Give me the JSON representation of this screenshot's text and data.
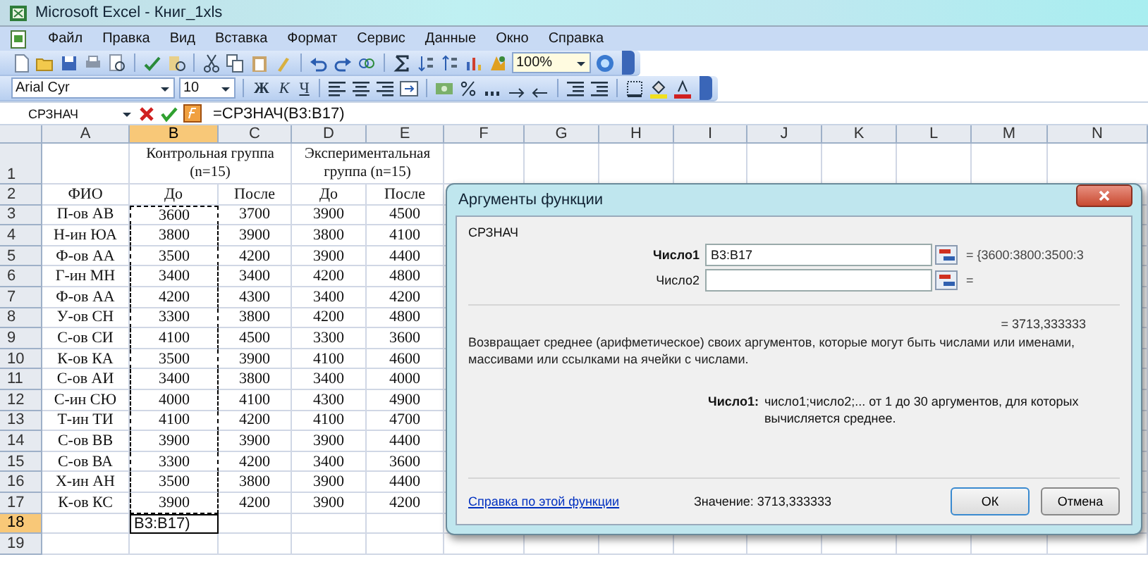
{
  "window": {
    "title": "Microsoft Excel - Книг_1xls"
  },
  "menu": [
    {
      "label": "Файл"
    },
    {
      "label": "Правка"
    },
    {
      "label": "Вид"
    },
    {
      "label": "Вставка"
    },
    {
      "label": "Формат"
    },
    {
      "label": "Сервис"
    },
    {
      "label": "Данные"
    },
    {
      "label": "Окно"
    },
    {
      "label": "Справка"
    }
  ],
  "standard_toolbar": {
    "zoom": "100%"
  },
  "format_toolbar": {
    "font": "Arial Cyr",
    "size": "10",
    "style_buttons": [
      "Ж",
      "К",
      "Ч"
    ]
  },
  "formula_bar": {
    "name_box": "СРЗНАЧ",
    "formula": "=СРЗНАЧ(B3:B17)"
  },
  "table": {
    "columns": [
      {
        "label": "A",
        "selected": false
      },
      {
        "label": "B",
        "selected": true
      },
      {
        "label": "C",
        "selected": false
      },
      {
        "label": "D",
        "selected": false
      },
      {
        "label": "E",
        "selected": false
      },
      {
        "label": "F",
        "selected": false
      },
      {
        "label": "G",
        "selected": false
      },
      {
        "label": "H",
        "selected": false
      },
      {
        "label": "I",
        "selected": false
      },
      {
        "label": "J",
        "selected": false
      },
      {
        "label": "K",
        "selected": false
      },
      {
        "label": "L",
        "selected": false
      },
      {
        "label": "M",
        "selected": false
      },
      {
        "label": "N",
        "selected": false
      }
    ],
    "rows": [
      {
        "number": "1",
        "selected": false
      },
      {
        "number": "2",
        "selected": false
      },
      {
        "number": "3",
        "selected": false
      },
      {
        "number": "4",
        "selected": false
      },
      {
        "number": "5",
        "selected": false
      },
      {
        "number": "6",
        "selected": false
      },
      {
        "number": "7",
        "selected": false
      },
      {
        "number": "8",
        "selected": false
      },
      {
        "number": "9",
        "selected": false
      },
      {
        "number": "10",
        "selected": false
      },
      {
        "number": "11",
        "selected": false
      },
      {
        "number": "12",
        "selected": false
      },
      {
        "number": "13",
        "selected": false
      },
      {
        "number": "14",
        "selected": false
      },
      {
        "number": "15",
        "selected": false
      },
      {
        "number": "16",
        "selected": false
      },
      {
        "number": "17",
        "selected": false
      },
      {
        "number": "18",
        "selected": true
      },
      {
        "number": "19",
        "selected": false
      }
    ],
    "group_headers": [
      "Контрольная группа (n=15)",
      "Экспериментальная группа (n=15)"
    ],
    "subheaders": [
      "ФИО",
      "До",
      "После",
      "До",
      "После"
    ],
    "records": [
      {
        "name": "П-ов АВ",
        "values": [
          "3600",
          "3700",
          "3900",
          "4500"
        ]
      },
      {
        "name": "Н-ин ЮА",
        "values": [
          "3800",
          "3900",
          "3800",
          "4100"
        ]
      },
      {
        "name": "Ф-ов АА",
        "values": [
          "3500",
          "4200",
          "3900",
          "4400"
        ]
      },
      {
        "name": "Г-ин МН",
        "values": [
          "3400",
          "3400",
          "4200",
          "4800"
        ]
      },
      {
        "name": "Ф-ов АА",
        "values": [
          "4200",
          "4300",
          "3400",
          "4200"
        ]
      },
      {
        "name": "У-ов СН",
        "values": [
          "3300",
          "3800",
          "4200",
          "4800"
        ]
      },
      {
        "name": "С-ов СИ",
        "values": [
          "4100",
          "4500",
          "3300",
          "3600"
        ]
      },
      {
        "name": "К-ов КА",
        "values": [
          "3500",
          "3900",
          "4100",
          "4600"
        ]
      },
      {
        "name": "С-ов АИ",
        "values": [
          "3400",
          "3800",
          "3400",
          "4000"
        ]
      },
      {
        "name": "С-ин СЮ",
        "values": [
          "4000",
          "4100",
          "4300",
          "4900"
        ]
      },
      {
        "name": "Т-ин ТИ",
        "values": [
          "4100",
          "4200",
          "4100",
          "4700"
        ]
      },
      {
        "name": "С-ов ВВ",
        "values": [
          "3900",
          "3900",
          "3900",
          "4400"
        ]
      },
      {
        "name": "С-ов ВА",
        "values": [
          "3300",
          "4200",
          "3400",
          "3600"
        ]
      },
      {
        "name": "Х-ин АН",
        "values": [
          "3500",
          "3800",
          "3900",
          "4400"
        ]
      },
      {
        "name": "К-ов КС",
        "values": [
          "3900",
          "4200",
          "3900",
          "4200"
        ]
      }
    ],
    "edit_cell": "B3:B17)"
  },
  "dialog": {
    "title": "Аргументы функции",
    "function": "СРЗНАЧ",
    "arguments": [
      {
        "label": "Число1",
        "bold": true,
        "value": "B3:B17",
        "result": "= {3600:3800:3500:3"
      },
      {
        "label": "Число2",
        "bold": false,
        "result": "="
      }
    ],
    "result": "= 3713,333333",
    "description": "Возвращает среднее (арифметическое) своих аргументов, которые могут быть числами или именами, массивами или ссылками на ячейки с числами.",
    "help_label": "Число1:",
    "help_text": "число1;число2;... от 1 до 30 аргументов, для которых вычисляется среднее.",
    "help_link": "Справка по этой функции",
    "value": "Значение: 3713,333333",
    "buttons": [
      "ОК",
      "Отмена"
    ]
  }
}
